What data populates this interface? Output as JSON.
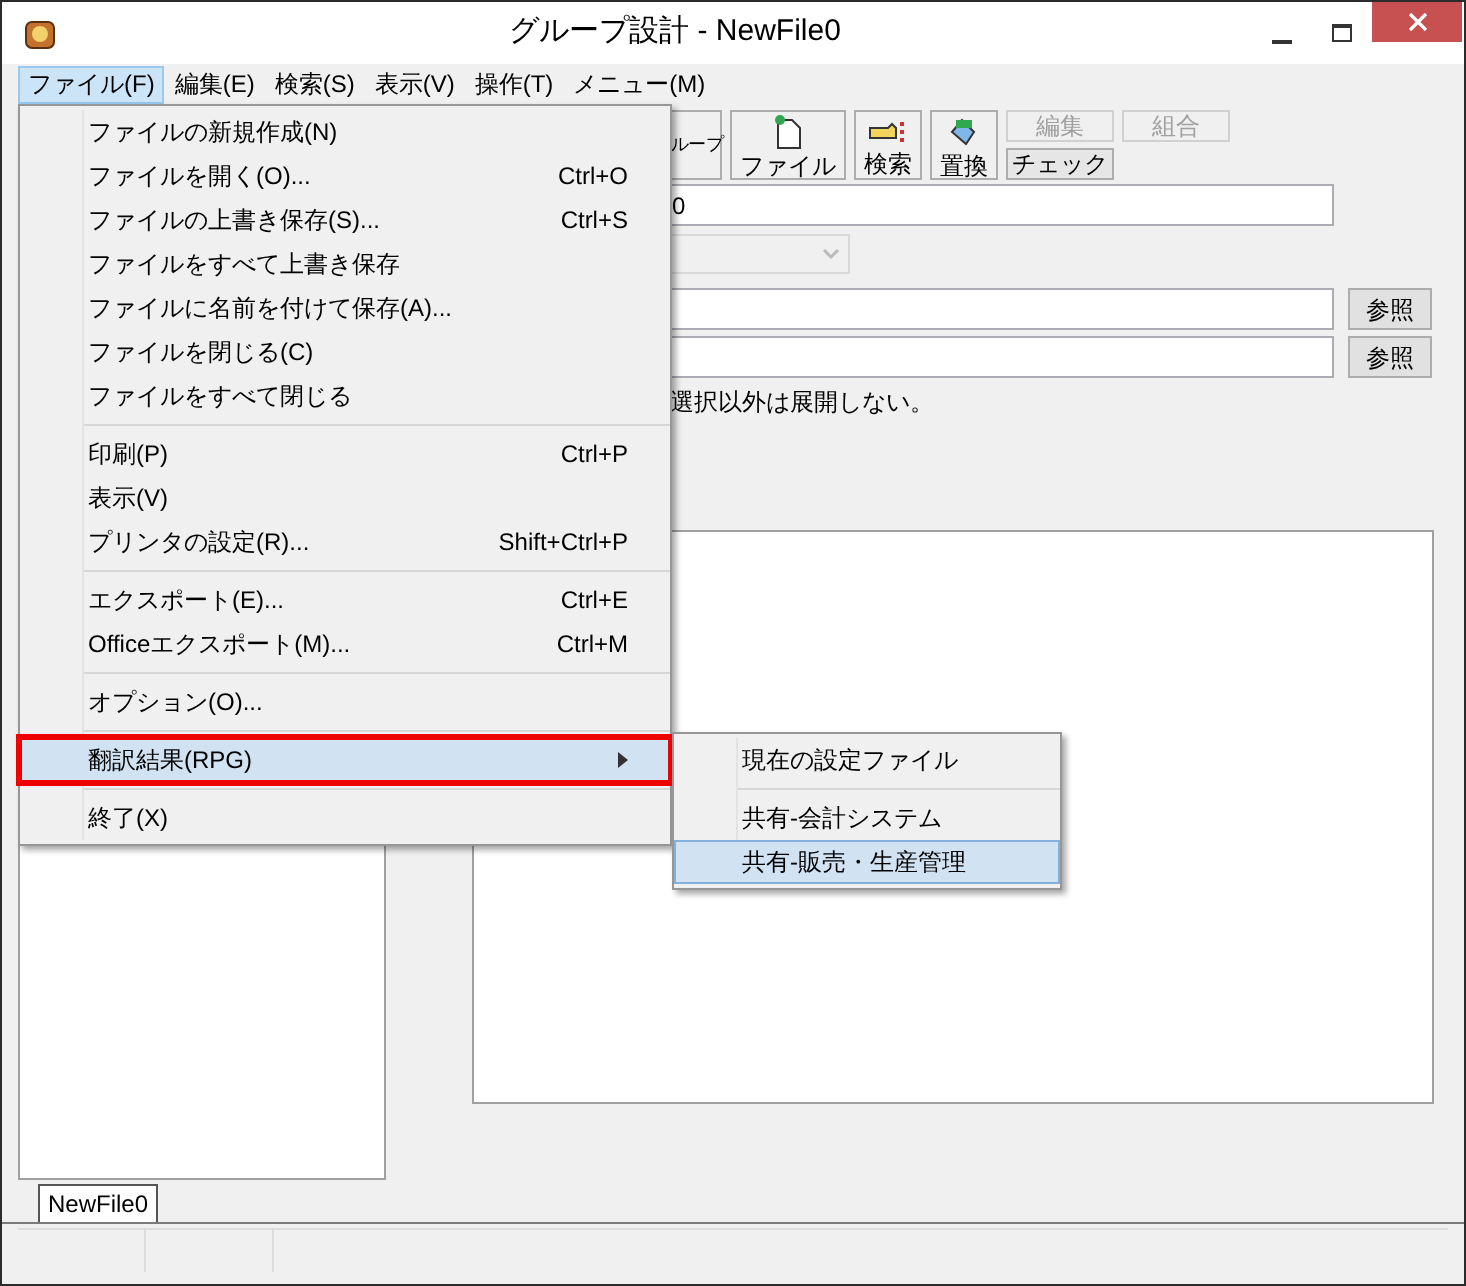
{
  "window": {
    "title": "グループ設計 - NewFile0"
  },
  "menu_bar": [
    {
      "label": "ファイル(F)",
      "selected": true
    },
    {
      "label": "編集(E)",
      "selected": false
    },
    {
      "label": "検索(S)",
      "selected": false
    },
    {
      "label": "表示(V)",
      "selected": false
    },
    {
      "label": "操作(T)",
      "selected": false
    },
    {
      "label": "メニュー(M)",
      "selected": false
    }
  ],
  "toolbar": [
    {
      "kind": "icon",
      "label": "ループ",
      "disabled": false
    },
    {
      "kind": "icon",
      "label": "ファイル",
      "disabled": false
    },
    {
      "kind": "icon",
      "label": "検索",
      "disabled": false
    },
    {
      "kind": "icon",
      "label": "置換",
      "disabled": false
    },
    {
      "kind": "stack",
      "top": {
        "label": "編集",
        "disabled": true
      },
      "bottom": {
        "label": "チェック",
        "disabled": false
      }
    },
    {
      "kind": "stack",
      "top": {
        "label": "組合",
        "disabled": true
      }
    }
  ],
  "form": {
    "name_field": {
      "value": "0"
    },
    "dropdown": {
      "disabled": true
    },
    "path_fields": [
      {
        "button": "参照"
      },
      {
        "button": "参照"
      }
    ],
    "note": "選択以外は展開しない。"
  },
  "document_tabs": [
    {
      "label": "NewFile0",
      "selected": true
    }
  ],
  "file_menu": [
    {
      "kind": "item",
      "label": "ファイルの新規作成(N)",
      "selected": false
    },
    {
      "kind": "item",
      "label": "ファイルを開く(O)...",
      "shortcut": "Ctrl+O",
      "selected": false
    },
    {
      "kind": "item",
      "label": "ファイルの上書き保存(S)...",
      "shortcut": "Ctrl+S",
      "selected": false
    },
    {
      "kind": "item",
      "label": "ファイルをすべて上書き保存",
      "selected": false
    },
    {
      "kind": "item",
      "label": "ファイルに名前を付けて保存(A)...",
      "selected": false
    },
    {
      "kind": "item",
      "label": "ファイルを閉じる(C)",
      "selected": false
    },
    {
      "kind": "item",
      "label": "ファイルをすべて閉じる",
      "selected": false
    },
    {
      "kind": "separator"
    },
    {
      "kind": "item",
      "label": "印刷(P)",
      "shortcut": "Ctrl+P",
      "selected": false
    },
    {
      "kind": "item",
      "label": "表示(V)",
      "selected": false
    },
    {
      "kind": "item",
      "label": "プリンタの設定(R)...",
      "shortcut": "Shift+Ctrl+P",
      "selected": false
    },
    {
      "kind": "separator"
    },
    {
      "kind": "item",
      "label": "エクスポート(E)...",
      "shortcut": "Ctrl+E",
      "selected": false
    },
    {
      "kind": "item",
      "label": "Officeエクスポート(M)...",
      "shortcut": "Ctrl+M",
      "selected": false
    },
    {
      "kind": "separator"
    },
    {
      "kind": "item",
      "label": "オプション(O)...",
      "selected": false
    },
    {
      "kind": "separator"
    },
    {
      "kind": "submenu",
      "label": "翻訳結果(RPG)",
      "selected": true,
      "outlined": true
    },
    {
      "kind": "separator"
    },
    {
      "kind": "item",
      "label": "終了(X)",
      "selected": false
    }
  ],
  "submenu": [
    {
      "kind": "item",
      "label": "現在の設定ファイル",
      "selected": false
    },
    {
      "kind": "separator"
    },
    {
      "kind": "item",
      "label": "共有-会計システム",
      "selected": false
    },
    {
      "kind": "item",
      "label": "共有-販売・生産管理",
      "selected": true
    }
  ]
}
